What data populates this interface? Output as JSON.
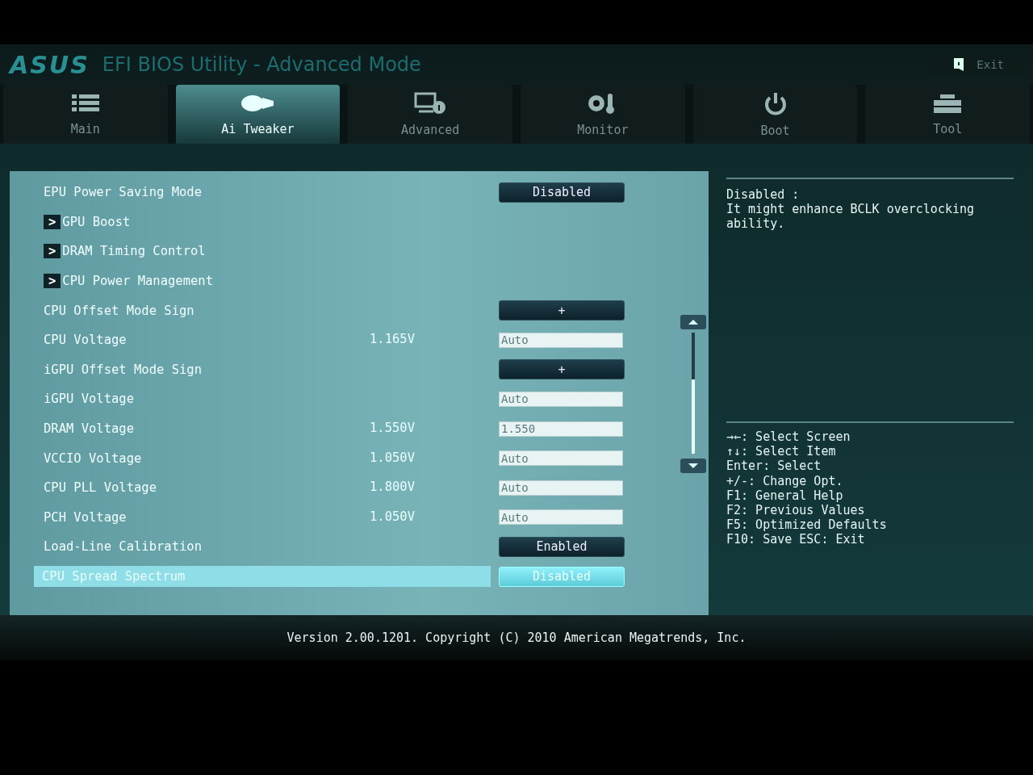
{
  "header": {
    "logo": "ASUS",
    "title": "EFI BIOS Utility - Advanced Mode",
    "exit": "Exit"
  },
  "tabs": [
    {
      "label": "Main",
      "selected": false
    },
    {
      "label": "Ai Tweaker",
      "selected": true
    },
    {
      "label": "Advanced",
      "selected": false
    },
    {
      "label": "Monitor",
      "selected": false
    },
    {
      "label": "Boot",
      "selected": false
    },
    {
      "label": "Tool",
      "selected": false
    }
  ],
  "settings": [
    {
      "kind": "option",
      "label": "EPU Power Saving Mode",
      "value": "Disabled",
      "selected": false
    },
    {
      "kind": "submenu",
      "marker": ">",
      "label": "GPU Boost",
      "selected": false
    },
    {
      "kind": "submenu",
      "marker": ">",
      "label": "DRAM Timing Control",
      "selected": false
    },
    {
      "kind": "submenu",
      "marker": ">",
      "label": "CPU Power Management",
      "selected": false
    },
    {
      "kind": "option",
      "label": "CPU Offset Mode Sign",
      "value": "+",
      "selected": false
    },
    {
      "kind": "field",
      "label": "CPU Voltage",
      "reading": "1.165V",
      "value": "Auto",
      "selected": false
    },
    {
      "kind": "option",
      "label": "iGPU Offset Mode Sign",
      "value": "+",
      "selected": false
    },
    {
      "kind": "field",
      "label": "iGPU Voltage",
      "value": "Auto",
      "selected": false
    },
    {
      "kind": "field",
      "label": "DRAM Voltage",
      "reading": "1.550V",
      "value": "1.550",
      "selected": false
    },
    {
      "kind": "field",
      "label": "VCCIO Voltage",
      "reading": "1.050V",
      "value": "Auto",
      "selected": false
    },
    {
      "kind": "field",
      "label": "CPU PLL Voltage",
      "reading": "1.800V",
      "value": "Auto",
      "selected": false
    },
    {
      "kind": "field",
      "label": "PCH Voltage",
      "reading": "1.050V",
      "value": "Auto",
      "selected": false
    },
    {
      "kind": "option",
      "label": "Load-Line Calibration",
      "value": "Enabled",
      "selected": false
    },
    {
      "kind": "option",
      "label": "CPU Spread Spectrum",
      "value": "Disabled",
      "selected": true
    }
  ],
  "help": {
    "title": "Disabled :",
    "text": "It might enhance BCLK overclocking ability."
  },
  "keys": [
    "→←: Select Screen",
    "↑↓: Select Item",
    "Enter: Select",
    "+/-: Change Opt.",
    "F1: General Help",
    "F2: Previous Values",
    "F5: Optimized Defaults",
    "F10: Save  ESC: Exit"
  ],
  "footer": "Version 2.00.1201. Copyright (C) 2010 American Megatrends, Inc."
}
